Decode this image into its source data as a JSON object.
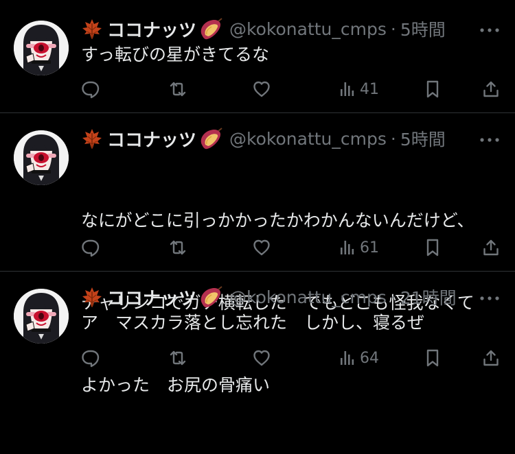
{
  "tweets": [
    {
      "display_name": "ココナッツ",
      "handle": "@kokonattu_cmps",
      "separator": "·",
      "time": "5時間",
      "text": "すっ転びの星がきてるな",
      "views": "41",
      "avatar_icon": "avatar-image",
      "name_prefix_icon": "maple-leaf-icon",
      "name_suffix_icon": "sweet-potato-icon"
    },
    {
      "display_name": "ココナッツ",
      "handle": "@kokonattu_cmps",
      "separator": "·",
      "time": "5時間",
      "text_lines": [
        "なにがどこに引っかかったかわかんないんだけど、",
        "チャリンコでガチ横転した　でもどこも怪我なくて",
        "よかった　お尻の骨痛い"
      ],
      "views": "61",
      "avatar_icon": "avatar-image",
      "name_prefix_icon": "maple-leaf-icon",
      "name_suffix_icon": "sweet-potato-icon"
    },
    {
      "display_name": "ココナッツ",
      "handle": "@kokonattu_cmps",
      "separator": "·",
      "time": "21時間",
      "text": "ア　マスカラ落とし忘れた　しかし、寝るぜ",
      "views": "64",
      "avatar_icon": "avatar-image",
      "name_prefix_icon": "maple-leaf-icon",
      "name_suffix_icon": "sweet-potato-icon"
    }
  ],
  "action_icons": [
    "reply-icon",
    "retweet-icon",
    "like-icon",
    "views-icon",
    "bookmark-icon",
    "share-icon"
  ],
  "colors": {
    "background": "#000000",
    "text_primary": "#e7e9ea",
    "text_secondary": "#71767b",
    "divider": "#2f3336",
    "leaf": "#c4421a",
    "potato_skin": "#b4304f"
  }
}
